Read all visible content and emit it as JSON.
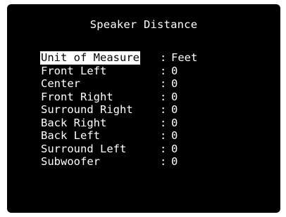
{
  "osd": {
    "title": "Speaker Distance",
    "separator": ":",
    "items": [
      {
        "label": "Unit of Measure",
        "value": "Feet",
        "selected": true
      },
      {
        "label": "Front Left",
        "value": "0",
        "selected": false
      },
      {
        "label": "Center",
        "value": "0",
        "selected": false
      },
      {
        "label": "Front Right",
        "value": "0",
        "selected": false
      },
      {
        "label": "Surround Right",
        "value": "0",
        "selected": false
      },
      {
        "label": "Back Right",
        "value": "0",
        "selected": false
      },
      {
        "label": "Back Left",
        "value": "0",
        "selected": false
      },
      {
        "label": "Surround Left",
        "value": "0",
        "selected": false
      },
      {
        "label": "Subwoofer",
        "value": "0",
        "selected": false
      }
    ],
    "colors": {
      "background": "#000000",
      "text": "#ffffff",
      "highlight_bg": "#ffffff",
      "highlight_text": "#000000"
    }
  }
}
